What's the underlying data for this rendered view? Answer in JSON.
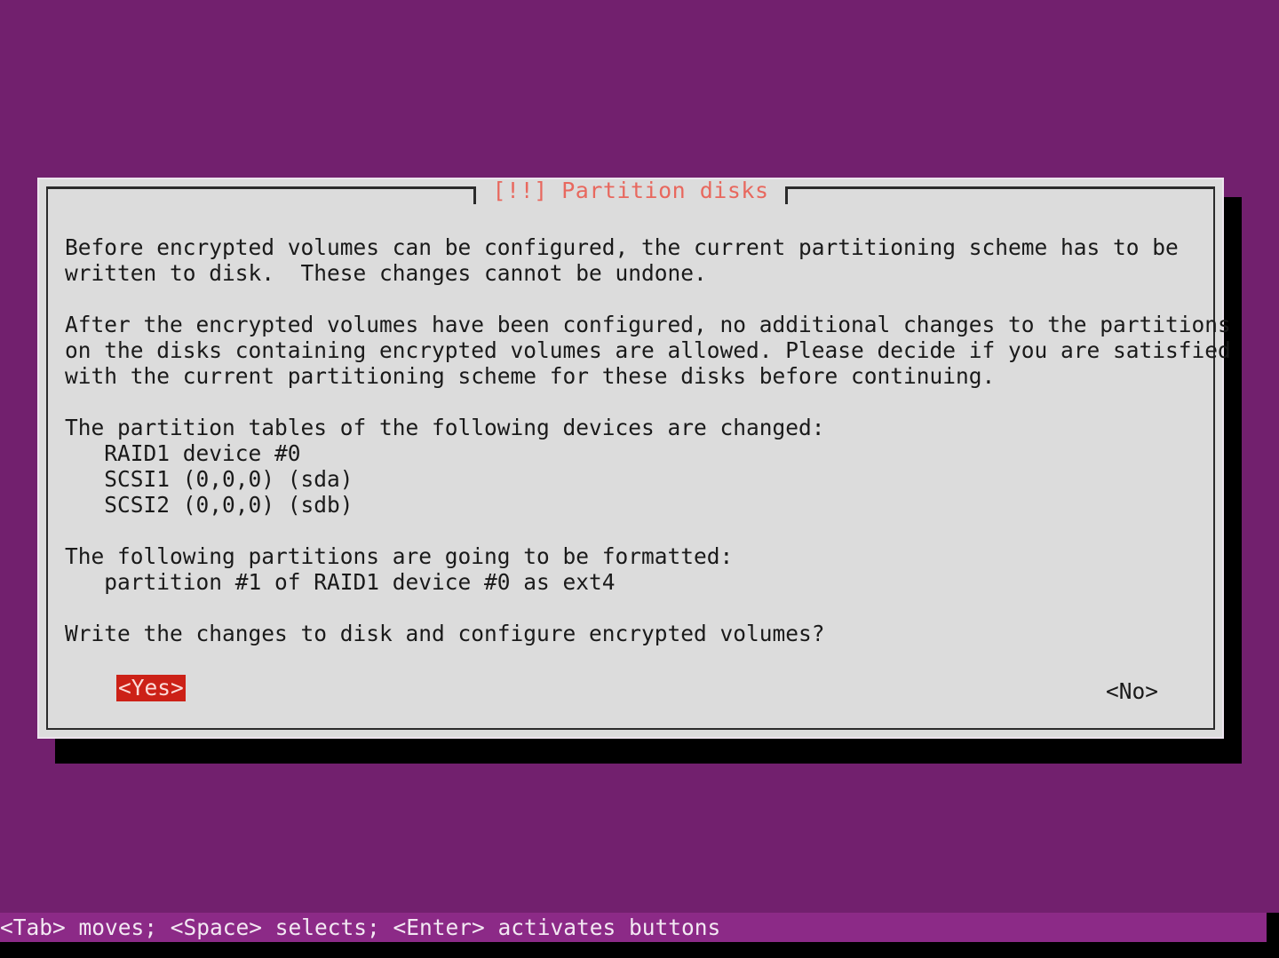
{
  "screen": {
    "background_color": "#72206e",
    "dialog_background_color": "#dcdcdc",
    "title_color": "#e8685e",
    "highlight_color": "#cc2117",
    "help_bar_color": "#8c2a87"
  },
  "dialog": {
    "title": "[!!] Partition disks",
    "paragraphs": [
      [
        "Before encrypted volumes can be configured, the current partitioning scheme has to be",
        "written to disk.  These changes cannot be undone."
      ],
      [
        "After the encrypted volumes have been configured, no additional changes to the partitions",
        "on the disks containing encrypted volumes are allowed. Please decide if you are satisfied",
        "with the current partitioning scheme for these disks before continuing."
      ],
      [
        "The partition tables of the following devices are changed:",
        "   RAID1 device #0",
        "   SCSI1 (0,0,0) (sda)",
        "   SCSI2 (0,0,0) (sdb)"
      ],
      [
        "The following partitions are going to be formatted:",
        "   partition #1 of RAID1 device #0 as ext4"
      ],
      [
        "Write the changes to disk and configure encrypted volumes?"
      ]
    ],
    "buttons": {
      "yes_label": "<Yes>",
      "no_label": "<No>",
      "selected": "yes"
    }
  },
  "help_bar": {
    "text": "<Tab> moves; <Space> selects; <Enter> activates buttons"
  }
}
